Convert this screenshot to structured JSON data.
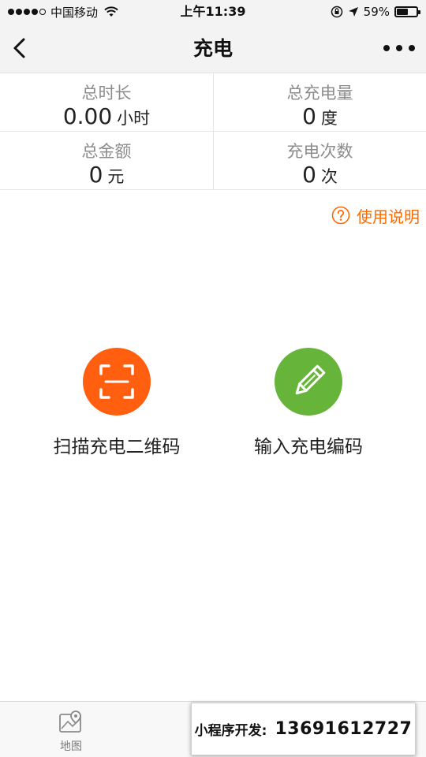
{
  "status_bar": {
    "carrier": "中国移动",
    "time": "上午11:39",
    "battery": "59%",
    "battery_level": 0.59
  },
  "nav": {
    "title": "充电"
  },
  "stats": [
    {
      "label": "总时长",
      "value": "0.00",
      "unit": "小时"
    },
    {
      "label": "总充电量",
      "value": "0",
      "unit": "度"
    },
    {
      "label": "总金额",
      "value": "0",
      "unit": "元"
    },
    {
      "label": "充电次数",
      "value": "0",
      "unit": "次"
    }
  ],
  "help": {
    "label": "使用说明"
  },
  "actions": {
    "scan_label": "扫描充电二维码",
    "code_label": "输入充电编码"
  },
  "tab_bar": {
    "map_label": "地图"
  },
  "contact": {
    "label": "小程序开发:",
    "phone": "13691612727"
  },
  "colors": {
    "accent_orange": "#ff6a00",
    "scan_button": "#ff5f0f",
    "code_button": "#67b43a"
  },
  "icons": {
    "back": "chevron-left-icon",
    "more": "more-dots-icon",
    "help": "question-circle-icon",
    "scan": "scan-frame-icon",
    "code": "pencil-icon",
    "map": "map-pin-icon"
  }
}
